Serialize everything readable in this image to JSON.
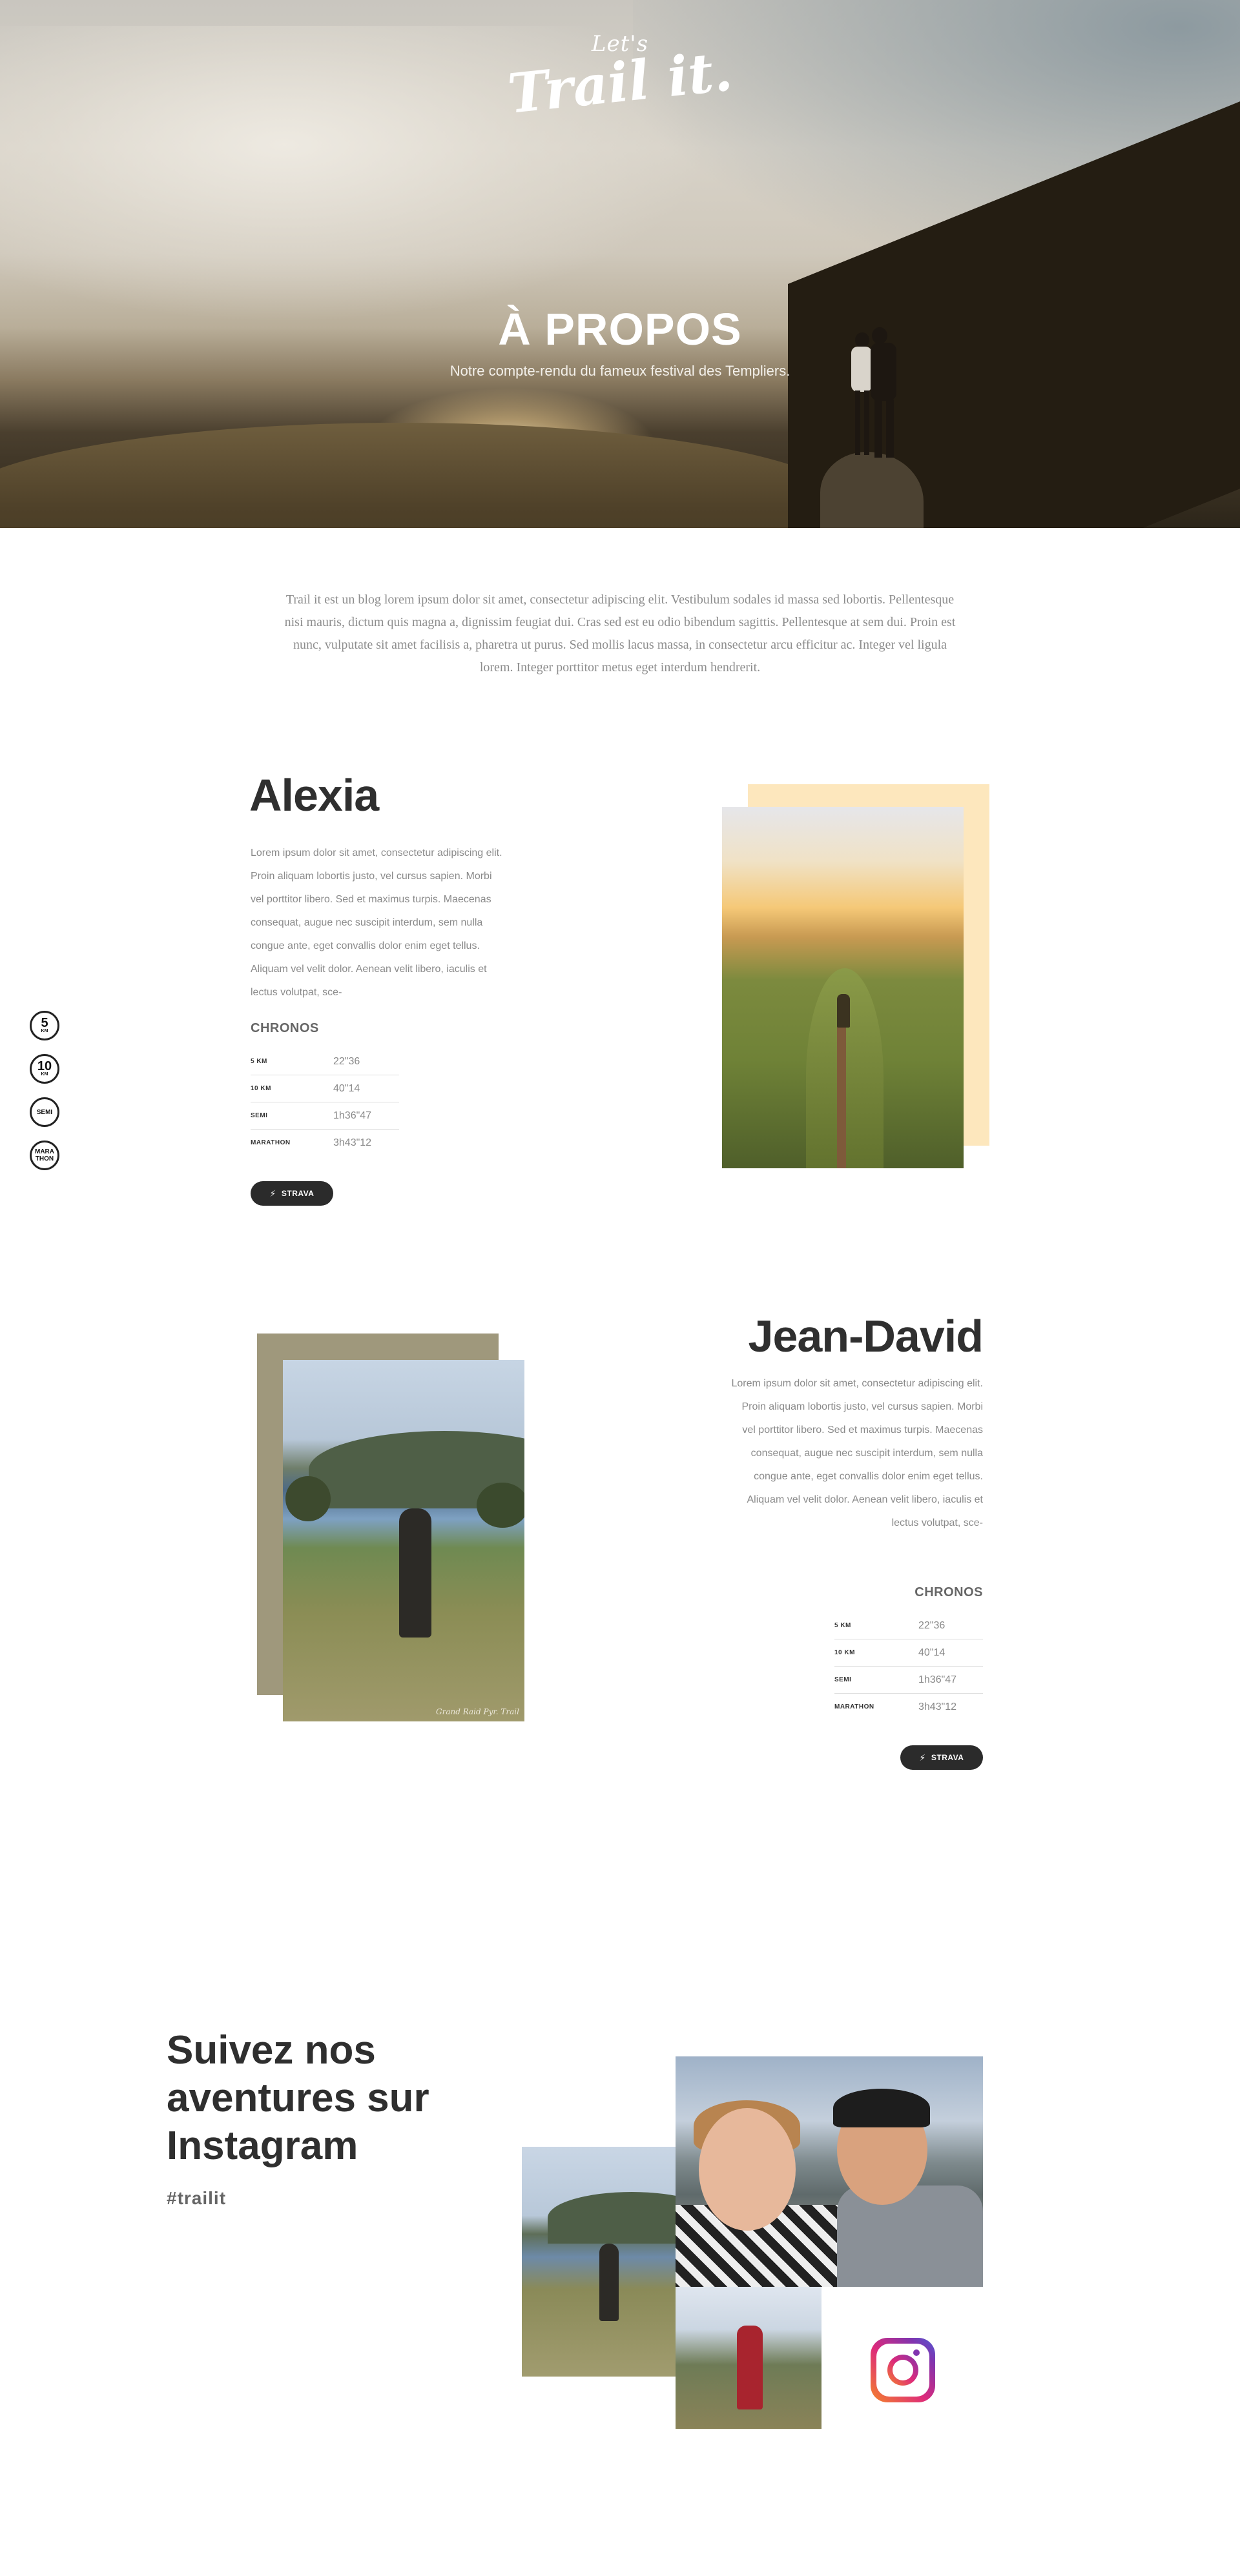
{
  "hero": {
    "logo_small": "Let's",
    "logo_big": "Trail it.",
    "title": "À PROPOS",
    "subtitle": "Notre compte-rendu du fameux festival des Templiers."
  },
  "intro": {
    "text": "Trail it est un blog lorem ipsum dolor sit amet, consectetur adipiscing elit. Vestibulum sodales id massa sed lobortis. Pellentesque nisi mauris, dictum quis magna a, dignissim feugiat dui. Cras sed est eu odio bibendum sagittis. Pellentesque at sem dui. Proin est nunc, vulputate sit amet facilisis a, pharetra ut purus. Sed mollis lacus massa, in consectetur arcu efficitur ac. Integer vel ligula lorem. Integer porttitor metus eget interdum hendrerit."
  },
  "sidenav": {
    "items": [
      {
        "big": "5",
        "small": "KM"
      },
      {
        "big": "10",
        "small": "KM"
      },
      {
        "label": "SEMI"
      },
      {
        "label_1": "MARA",
        "label_2": "THON"
      }
    ]
  },
  "alexia": {
    "name": "Alexia",
    "bio": "Lorem ipsum dolor sit amet, consectetur adipiscing elit. Proin aliquam lobortis justo, vel cursus sapien. Morbi vel porttitor libero. Sed et maximus turpis. Maecenas consequat, augue nec suscipit interdum, sem nulla congue ante, eget convallis dolor enim eget tellus. Aliquam vel velit dolor. Aenean velit libero, iaculis et lectus volutpat, sce-",
    "chronos_title": "CHRONOS",
    "chronos": [
      {
        "label": "5 KM",
        "time": "22\"36"
      },
      {
        "label": "10 KM",
        "time": "40\"14"
      },
      {
        "label": "SEMI",
        "time": "1h36\"47"
      },
      {
        "label": "MARATHON",
        "time": "3h43\"12"
      }
    ],
    "strava_label": "STRAVA"
  },
  "jean_david": {
    "name": "Jean-David",
    "bio": "Lorem ipsum dolor sit amet, consectetur adipiscing elit. Proin aliquam lobortis justo, vel cursus sapien. Morbi vel porttitor libero. Sed et maximus turpis. Maecenas consequat, augue nec suscipit interdum, sem nulla congue ante, eget convallis dolor enim eget tellus. Aliquam vel velit dolor. Aenean velit libero, iaculis et lectus volutpat, sce-",
    "chronos_title": "CHRONOS",
    "chronos": [
      {
        "label": "5 KM",
        "time": "22\"36"
      },
      {
        "label": "10 KM",
        "time": "40\"14"
      },
      {
        "label": "SEMI",
        "time": "1h36\"47"
      },
      {
        "label": "MARATHON",
        "time": "3h43\"12"
      }
    ],
    "strava_label": "STRAVA",
    "photo_watermark": "Grand Raid Pyr. Trail"
  },
  "instagram": {
    "title_line1": "Suivez nos",
    "title_line2": "aventures sur",
    "title_line3": "Instagram",
    "hashtag": "#trailit",
    "icon": "instagram-icon"
  },
  "colors": {
    "dark": "#2f2f2f",
    "alexia_accent": "#fde7bd",
    "jd_accent": "#9f987c",
    "strava_button": "#2b2b2b"
  }
}
